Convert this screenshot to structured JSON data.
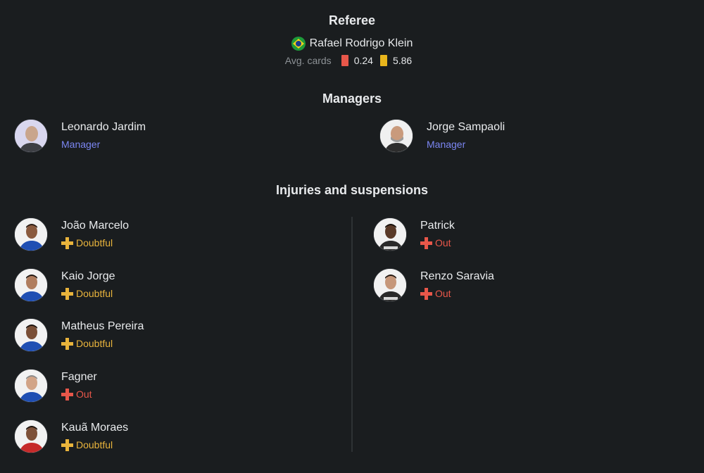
{
  "referee": {
    "title": "Referee",
    "name": "Rafael Rodrigo Klein",
    "flag_icon": "brazil-flag-icon",
    "avg_label": "Avg. cards",
    "red_avg": "0.24",
    "yellow_avg": "5.86",
    "colors": {
      "red": "#e8574a",
      "yellow": "#e8b51c"
    }
  },
  "managers": {
    "title": "Managers",
    "items": [
      {
        "name": "Leonardo Jardim",
        "role": "Manager"
      },
      {
        "name": "Jorge Sampaoli",
        "role": "Manager"
      }
    ]
  },
  "injuries": {
    "title": "Injuries and suspensions",
    "home": [
      {
        "name": "João Marcelo",
        "status": "Doubtful"
      },
      {
        "name": "Kaio Jorge",
        "status": "Doubtful"
      },
      {
        "name": "Matheus Pereira",
        "status": "Doubtful"
      },
      {
        "name": "Fagner",
        "status": "Out"
      },
      {
        "name": "Kauã Moraes",
        "status": "Doubtful"
      }
    ],
    "away": [
      {
        "name": "Patrick",
        "status": "Out"
      },
      {
        "name": "Renzo Saravia",
        "status": "Out"
      }
    ],
    "colors": {
      "doubtful": "#e9b43c",
      "out": "#e8574a"
    }
  }
}
